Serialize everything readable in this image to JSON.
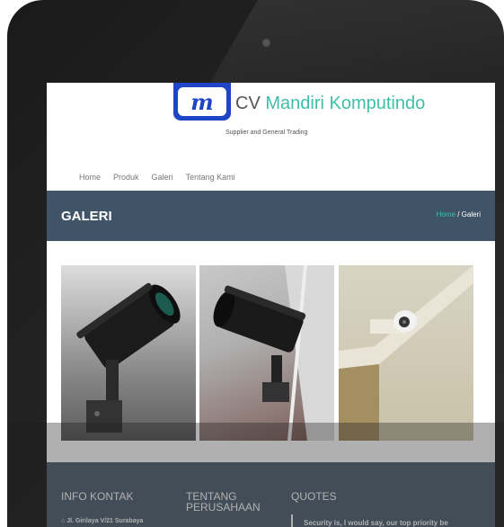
{
  "header": {
    "brand_prefix": "CV",
    "brand_name": "Mandiri Komputindo",
    "tagline": "Supplier and General Trading"
  },
  "nav": {
    "items": [
      "Home",
      "Produk",
      "Galeri",
      "Tentang Kami"
    ]
  },
  "hero": {
    "title": "GALERI",
    "breadcrumb_home": "Home",
    "breadcrumb_sep": "/",
    "breadcrumb_current": "Galeri"
  },
  "footer": {
    "info_title": "INFO KONTAK",
    "about_title_line1": "TENTANG",
    "about_title_line2": "PERUSAHAAN",
    "quotes_title": "QUOTES",
    "address": "Jl. Girilaya V/21 Surabaya",
    "quote_text": "Security is, I would say, our top priority be"
  }
}
